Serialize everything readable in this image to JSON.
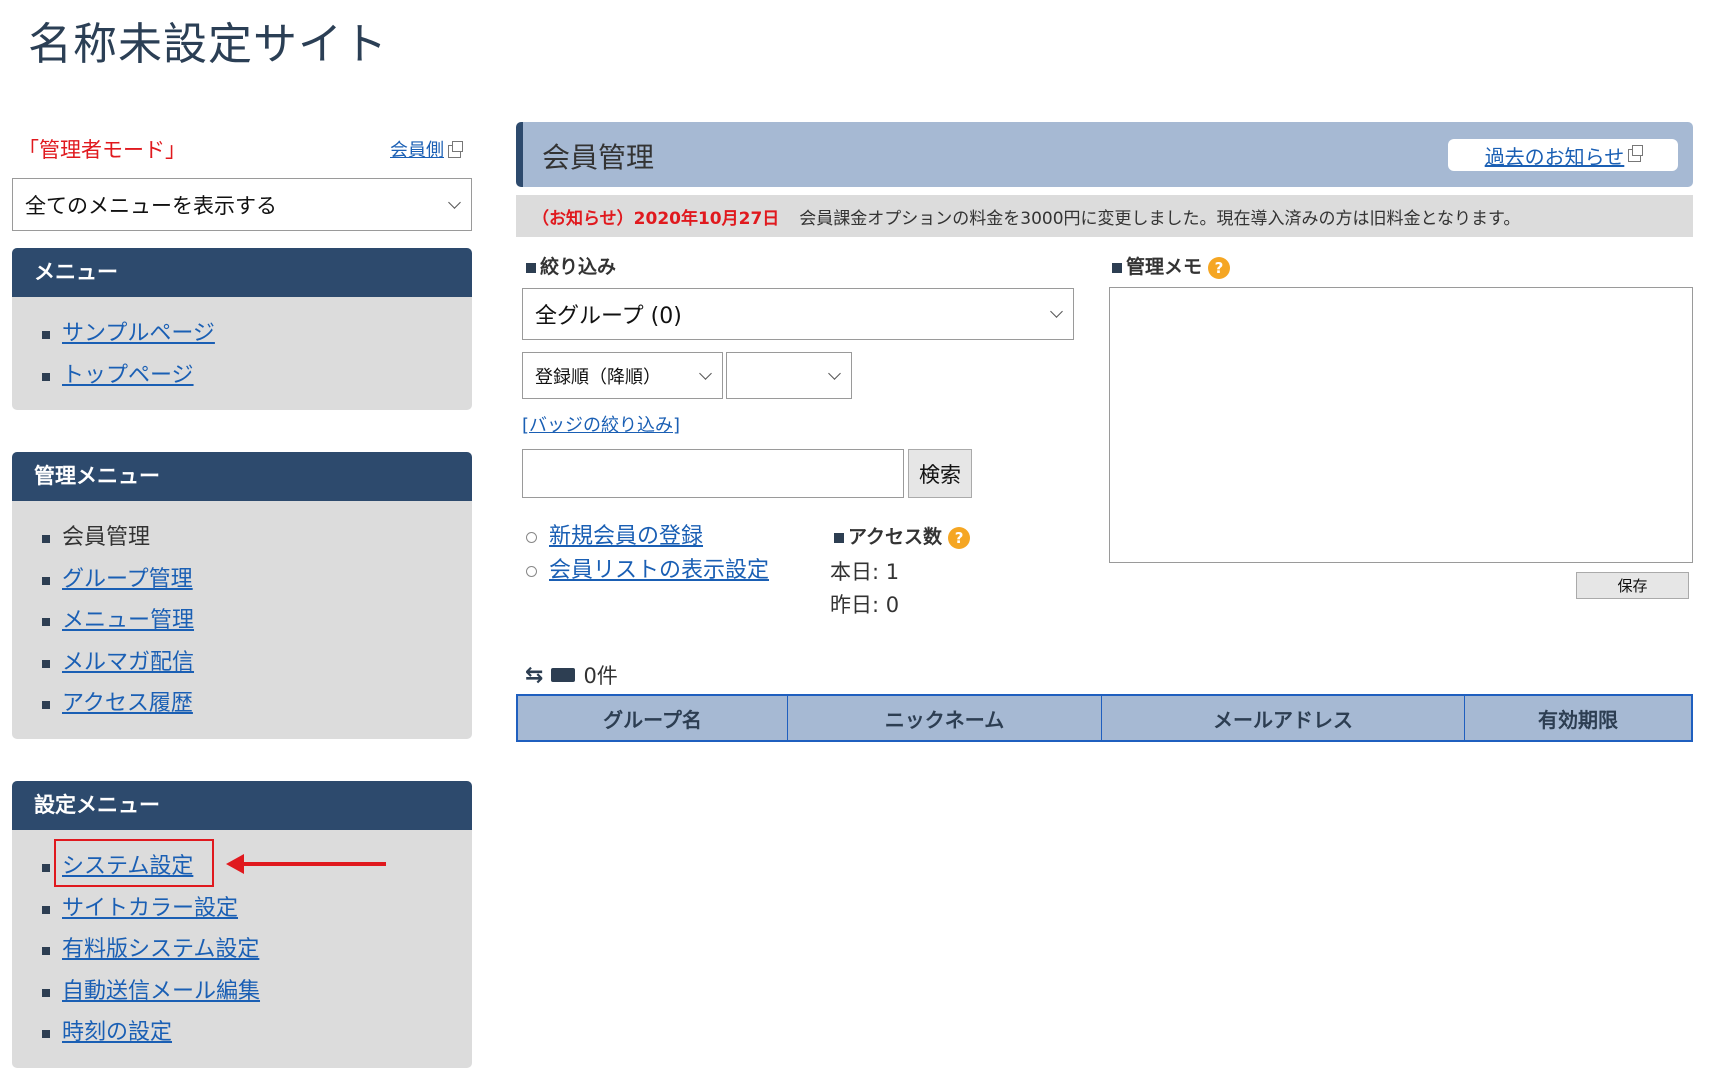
{
  "site_title": "名称未設定サイト",
  "admin_mode_label": "「管理者モード」",
  "member_side_link": "会員側",
  "menu_filter": {
    "selected": "全てのメニューを表示する"
  },
  "panels": {
    "menu": {
      "title": "メニュー",
      "items": [
        {
          "label": "サンプルページ"
        },
        {
          "label": "トップページ"
        }
      ]
    },
    "admin_menu": {
      "title": "管理メニュー",
      "items": [
        {
          "label": "会員管理"
        },
        {
          "label": "グループ管理"
        },
        {
          "label": "メニュー管理"
        },
        {
          "label": "メルマガ配信"
        },
        {
          "label": "アクセス履歴"
        }
      ]
    },
    "settings_menu": {
      "title": "設定メニュー",
      "items": [
        {
          "label": "システム設定"
        },
        {
          "label": "サイトカラー設定"
        },
        {
          "label": "有料版システム設定"
        },
        {
          "label": "自動送信メール編集"
        },
        {
          "label": "時刻の設定"
        }
      ]
    }
  },
  "main": {
    "title": "会員管理",
    "past_notices_button": "過去のお知らせ",
    "notice": {
      "prefix": "（お知らせ）2020年10月27日",
      "text": "会員課金オプションの料金を3000円に変更しました。現在導入済みの方は旧料金となります。"
    },
    "filter": {
      "label": "絞り込み",
      "group_selected": "全グループ (0)",
      "order_selected": "登録順（降順）",
      "order2_selected": "",
      "badge_filter_link": "[バッジの絞り込み]",
      "search_value": "",
      "search_button": "検索"
    },
    "links": [
      {
        "label": "新規会員の登録"
      },
      {
        "label": "会員リストの表示設定"
      }
    ],
    "access": {
      "label": "アクセス数",
      "today": "本日: 1",
      "yesterday": "昨日: 0"
    },
    "memo": {
      "label": "管理メモ",
      "value": "",
      "save_button": "保存"
    },
    "list_count": "0件",
    "table": {
      "columns": [
        "グループ名",
        "ニックネーム",
        "メールアドレス",
        "有効期限"
      ]
    }
  },
  "colors": {
    "panel_header": "#2d4a6d",
    "panel_bg": "#dcdcdc",
    "link": "#1a5fb4",
    "alert": "#e0191e",
    "table_header": "#a6b9d3",
    "help": "#f5a623"
  }
}
